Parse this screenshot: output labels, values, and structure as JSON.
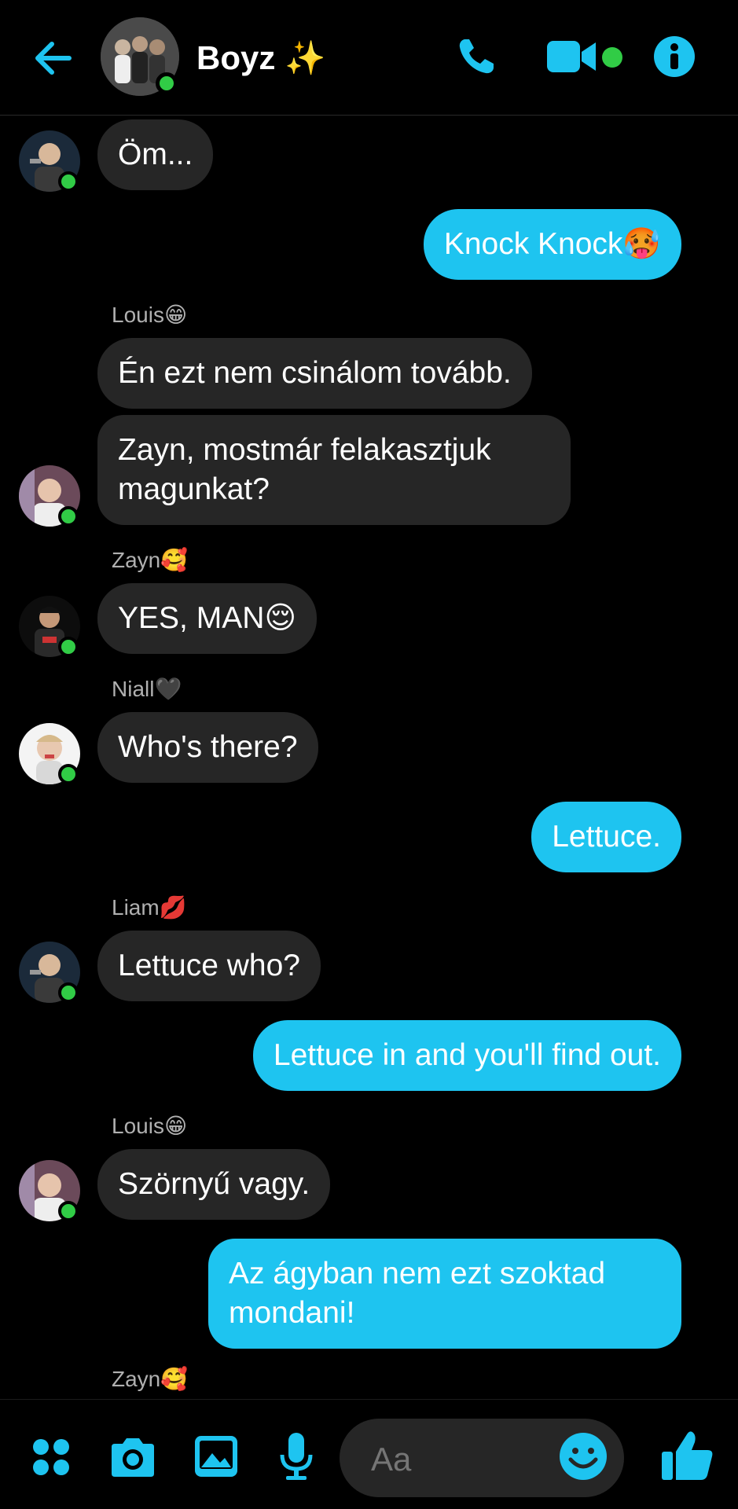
{
  "header": {
    "title": "Boyz ✨"
  },
  "messages": [
    {
      "side": "in",
      "text": "Öm..."
    },
    {
      "side": "out",
      "text": "Knock Knock🥵"
    },
    {
      "sender": "Louis😁"
    },
    {
      "side": "in",
      "text": "Én ezt nem csinálom tovább."
    },
    {
      "side": "in",
      "text": "Zayn, mostmár felakasztjuk",
      "text2": "magunkat?"
    },
    {
      "sender": "Zayn🥰"
    },
    {
      "side": "in",
      "text": "YES, MAN😌"
    },
    {
      "sender": "Niall🖤"
    },
    {
      "side": "in",
      "text": "Who's there?"
    },
    {
      "side": "out",
      "text": "Lettuce."
    },
    {
      "sender": "Liam💋"
    },
    {
      "side": "in",
      "text": "Lettuce who?"
    },
    {
      "side": "out",
      "text": "Lettuce in and you'll find out."
    },
    {
      "sender": "Louis😁"
    },
    {
      "side": "in",
      "text": "Szörnyű vagy."
    },
    {
      "side": "out",
      "text": "Az ágyban nem ezt szoktad",
      "text2": "mondani!"
    },
    {
      "sender": "Zayn🥰"
    }
  ],
  "composer": {
    "placeholder": "Aa"
  },
  "colors": {
    "accent": "#1ec4f0",
    "incoming_bubble": "#262626",
    "online": "#31cc46"
  },
  "icons": [
    "back-arrow-icon",
    "phone-icon",
    "video-camera-icon",
    "info-icon",
    "apps-icon",
    "camera-icon",
    "image-icon",
    "microphone-icon",
    "emoji-icon",
    "thumbs-up-icon"
  ]
}
